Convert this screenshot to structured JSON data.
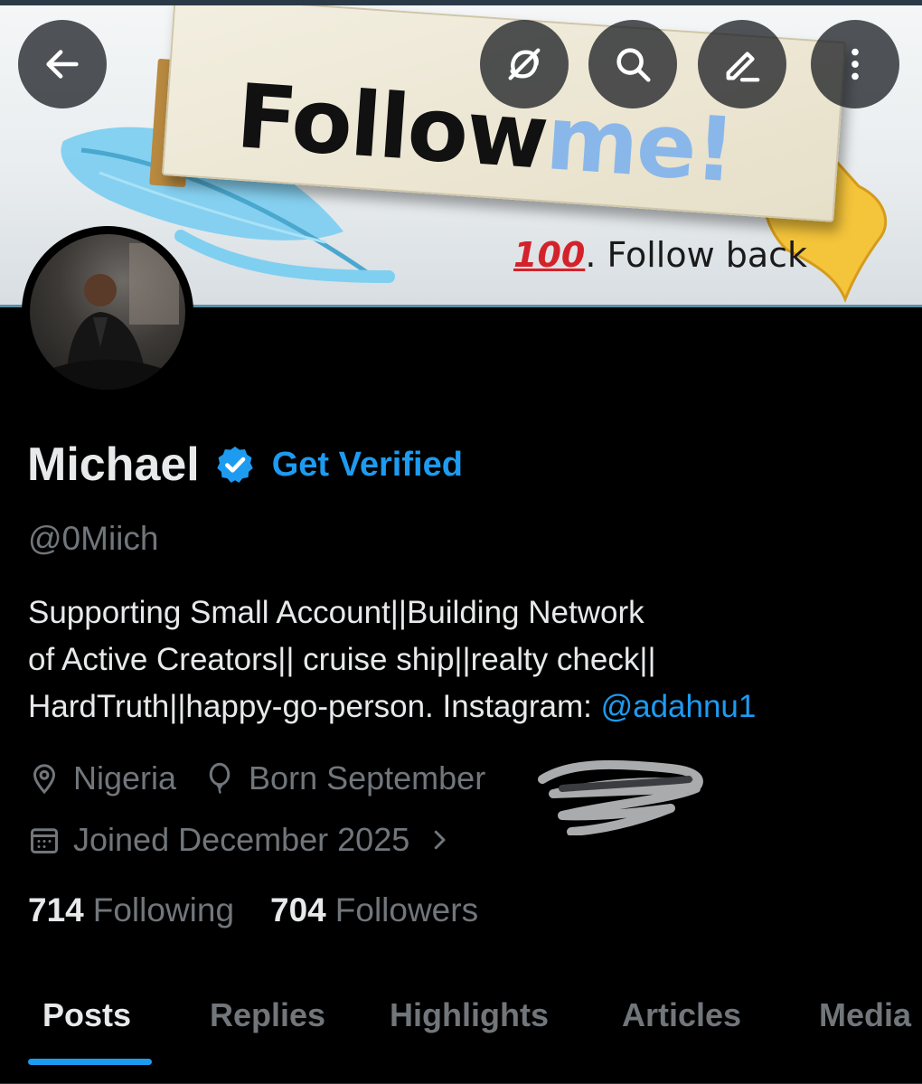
{
  "banner": {
    "follow_text": "Follow",
    "me_text": "me!",
    "hundred_emoji": "100",
    "follow_back_text": ". Follow back"
  },
  "toolbar": {
    "back": "arrow-left-icon",
    "grok": "grok-icon",
    "search": "search-icon",
    "edit": "edit-icon",
    "more": "more-vertical-icon"
  },
  "profile": {
    "name": "Michael",
    "get_verified": "Get Verified",
    "handle": "@0Miich",
    "bio_lines": [
      "Supporting Small Account||Building Network",
      "of Active Creators|| cruise ship||realty check||",
      "HardTruth||happy-go-person.  Instagram: "
    ],
    "bio_link": "@adahnu1",
    "location": "Nigeria",
    "born": "Born September",
    "joined": "Joined December 2025"
  },
  "stats": {
    "following_count": "714",
    "following_label": "Following",
    "followers_count": "704",
    "followers_label": "Followers"
  },
  "tabs": [
    "Posts",
    "Replies",
    "Highlights",
    "Articles",
    "Media"
  ],
  "colors": {
    "accent": "#1d9bf0",
    "muted": "#71767b",
    "text": "#e7e9ea",
    "background": "#000000"
  }
}
